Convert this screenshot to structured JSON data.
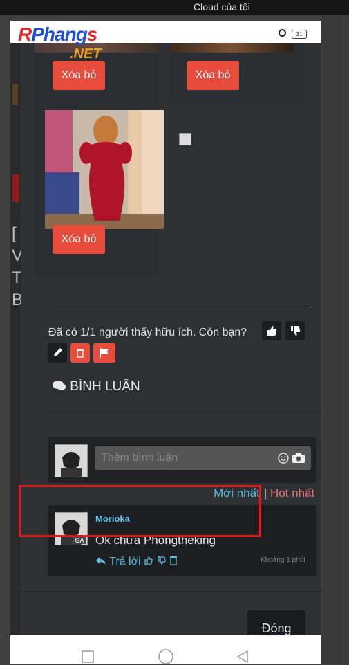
{
  "window": {
    "title": "Cloud của tôi"
  },
  "site": {
    "logo_main": "Phang",
    "logo_first": "R",
    "logo_last": "s",
    "logo_suffix": ".NET"
  },
  "status": {
    "battery": "31"
  },
  "gallery": {
    "delete_label": "Xóa bỏ"
  },
  "bg": {
    "text": "[V T B"
  },
  "review": {
    "helpful_text": "Đã có 1/1 người thấy hữu ích. Còn bạn?"
  },
  "comments": {
    "section_title": "BÌNH LUẬN",
    "input_placeholder": "Thêm bình luận",
    "sort_newest": "Mới nhất",
    "sort_sep": "|",
    "sort_hot": "Hot nhất",
    "items": [
      {
        "author": "Morioka",
        "avatar_badge": "GA",
        "text": "Ok chưa Phongtheking",
        "reply": "Trả lời",
        "time": "Khoảng 1 phút"
      }
    ]
  },
  "footer": {
    "close_label": "Đóng"
  },
  "colors": {
    "accent": "#e74c3c",
    "link": "#5bc0de",
    "hot": "#e57373",
    "author": "#5ec8f0"
  }
}
